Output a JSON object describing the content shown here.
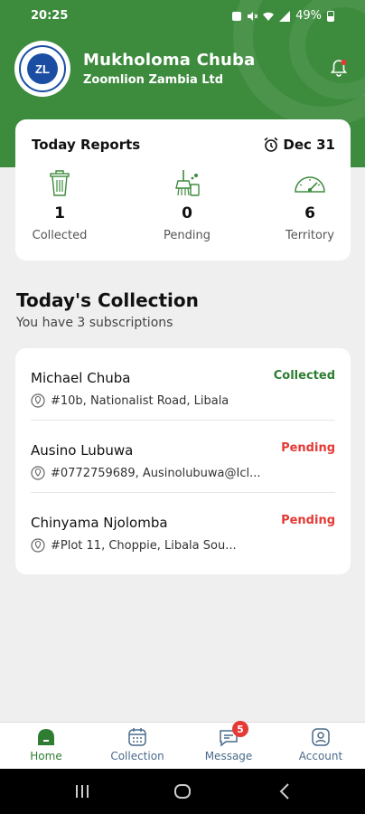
{
  "status_bar": {
    "time": "20:25",
    "battery": "49%"
  },
  "profile": {
    "name": "Mukholoma Chuba",
    "company": "Zoomlion Zambia Ltd",
    "logo_text": "ZL"
  },
  "reports": {
    "title": "Today Reports",
    "date": "Dec 31",
    "metrics": [
      {
        "icon": "trash-bin-icon",
        "value": "1",
        "label": "Collected"
      },
      {
        "icon": "cleaning-broom-icon",
        "value": "0",
        "label": "Pending"
      },
      {
        "icon": "speedometer-icon",
        "value": "6",
        "label": "Territory"
      }
    ]
  },
  "collection": {
    "title": "Today's Collection",
    "subtitle": "You have 3 subscriptions",
    "items": [
      {
        "name": "Michael Chuba",
        "status": "Collected",
        "address": "#10b, Nationalist Road, Libala"
      },
      {
        "name": "Ausino Lubuwa",
        "status": "Pending",
        "address": "#0772759689, Ausinolubuwa@Icl..."
      },
      {
        "name": "Chinyama Njolomba",
        "status": "Pending",
        "address": "#Plot 11, Choppie, Libala Sou..."
      }
    ]
  },
  "bottom_nav": {
    "items": [
      {
        "label": "Home",
        "icon": "home-icon"
      },
      {
        "label": "Collection",
        "icon": "calendar-icon"
      },
      {
        "label": "Message",
        "icon": "message-icon",
        "badge": "5"
      },
      {
        "label": "Account",
        "icon": "account-icon"
      }
    ]
  },
  "colors": {
    "primary_green": "#3d8b3d",
    "pending_red": "#e53935",
    "collected_green": "#2e7d32"
  }
}
